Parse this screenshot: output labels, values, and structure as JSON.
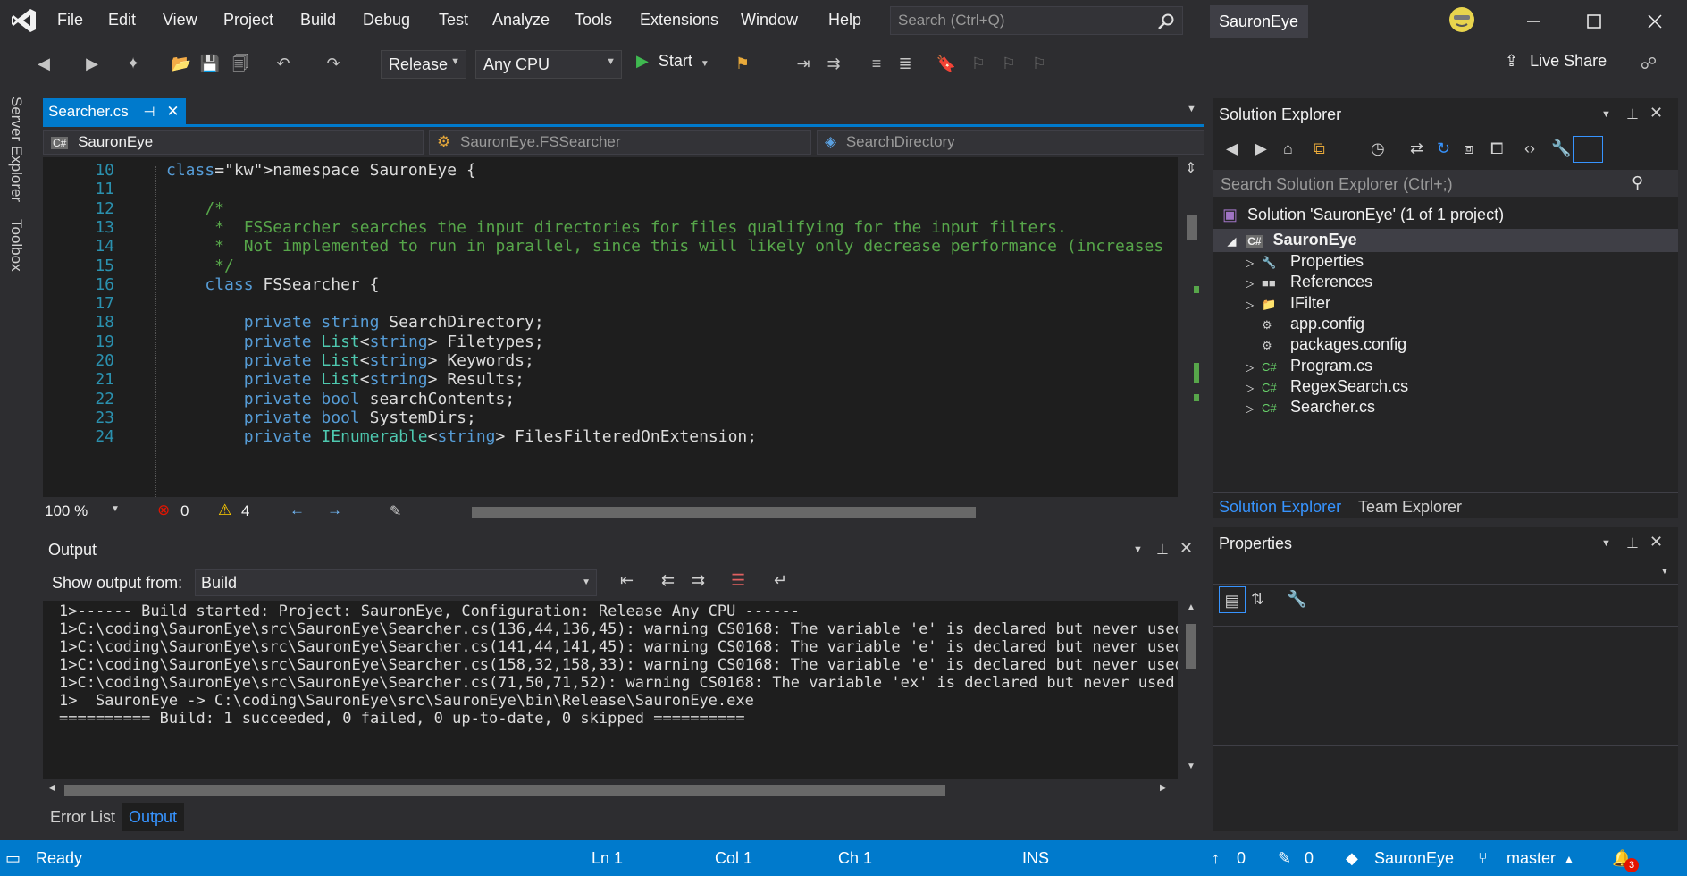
{
  "menu": [
    "File",
    "Edit",
    "View",
    "Project",
    "Build",
    "Debug",
    "Test",
    "Analyze",
    "Tools",
    "Extensions",
    "Window",
    "Help"
  ],
  "search": {
    "placeholder": "Search (Ctrl+Q)"
  },
  "window_title": "SauronEye",
  "toolbar": {
    "config": "Release",
    "platform": "Any CPU",
    "start": "Start",
    "live_share": "Live Share"
  },
  "side_tabs": [
    "Server Explorer",
    "Toolbox"
  ],
  "document_tab": {
    "name": "Searcher.cs"
  },
  "nav_bar": {
    "project": "SauronEye",
    "class": "SauronEye.FSSearcher",
    "member": "SearchDirectory"
  },
  "editor_footer": {
    "zoom": "100 %",
    "errors": "0",
    "warnings": "4"
  },
  "code_lines": [
    {
      "ln": "10",
      "code": "namespace SauronEye {"
    },
    {
      "ln": "11",
      "code": ""
    },
    {
      "ln": "12",
      "code": "    /*"
    },
    {
      "ln": "13",
      "code": "     *  FSSearcher searches the input directories for files qualifying for the input filters."
    },
    {
      "ln": "14",
      "code": "     *  Not implemented to run in parallel, since this will likely only decrease performance (increases"
    },
    {
      "ln": "15",
      "code": "     */"
    },
    {
      "ln": "16",
      "code": "    class FSSearcher {"
    },
    {
      "ln": "17",
      "code": ""
    },
    {
      "ln": "18",
      "code": "        private string SearchDirectory;"
    },
    {
      "ln": "19",
      "code": "        private List<string> Filetypes;"
    },
    {
      "ln": "20",
      "code": "        private List<string> Keywords;"
    },
    {
      "ln": "21",
      "code": "        private List<string> Results;"
    },
    {
      "ln": "22",
      "code": "        private bool searchContents;"
    },
    {
      "ln": "23",
      "code": "        private bool SystemDirs;"
    },
    {
      "ln": "24",
      "code": "        private IEnumerable<string> FilesFilteredOnExtension;"
    }
  ],
  "output": {
    "title": "Output",
    "show_from_label": "Show output from:",
    "source": "Build",
    "lines": [
      "1>------ Build started: Project: SauronEye, Configuration: Release Any CPU ------",
      "1>C:\\coding\\SauronEye\\src\\SauronEye\\Searcher.cs(136,44,136,45): warning CS0168: The variable 'e' is declared but never used",
      "1>C:\\coding\\SauronEye\\src\\SauronEye\\Searcher.cs(141,44,141,45): warning CS0168: The variable 'e' is declared but never used",
      "1>C:\\coding\\SauronEye\\src\\SauronEye\\Searcher.cs(158,32,158,33): warning CS0168: The variable 'e' is declared but never used",
      "1>C:\\coding\\SauronEye\\src\\SauronEye\\Searcher.cs(71,50,71,52): warning CS0168: The variable 'ex' is declared but never used",
      "1>  SauronEye -> C:\\coding\\SauronEye\\src\\SauronEye\\bin\\Release\\SauronEye.exe",
      "========== Build: 1 succeeded, 0 failed, 0 up-to-date, 0 skipped =========="
    ],
    "tabs": [
      "Error List",
      "Output"
    ]
  },
  "solution_explorer": {
    "title": "Solution Explorer",
    "search_placeholder": "Search Solution Explorer (Ctrl+;)",
    "solution": "Solution 'SauronEye' (1 of 1 project)",
    "project": "SauronEye",
    "items": [
      "Properties",
      "References",
      "IFilter",
      "app.config",
      "packages.config",
      "Program.cs",
      "RegexSearch.cs",
      "Searcher.cs"
    ],
    "tabs": [
      "Solution Explorer",
      "Team Explorer"
    ]
  },
  "properties": {
    "title": "Properties"
  },
  "status": {
    "ready": "Ready",
    "ln": "Ln 1",
    "col": "Col 1",
    "ch": "Ch 1",
    "ins": "INS",
    "up": "0",
    "pencil": "0",
    "repo": "SauronEye",
    "branch": "master",
    "notif": "3"
  },
  "colors": {
    "accent": "#007acc",
    "background": "#2d2d30",
    "editor": "#1e1e1e",
    "keyword": "#569cd6",
    "type": "#4ec9b0",
    "comment": "#57a64a"
  }
}
